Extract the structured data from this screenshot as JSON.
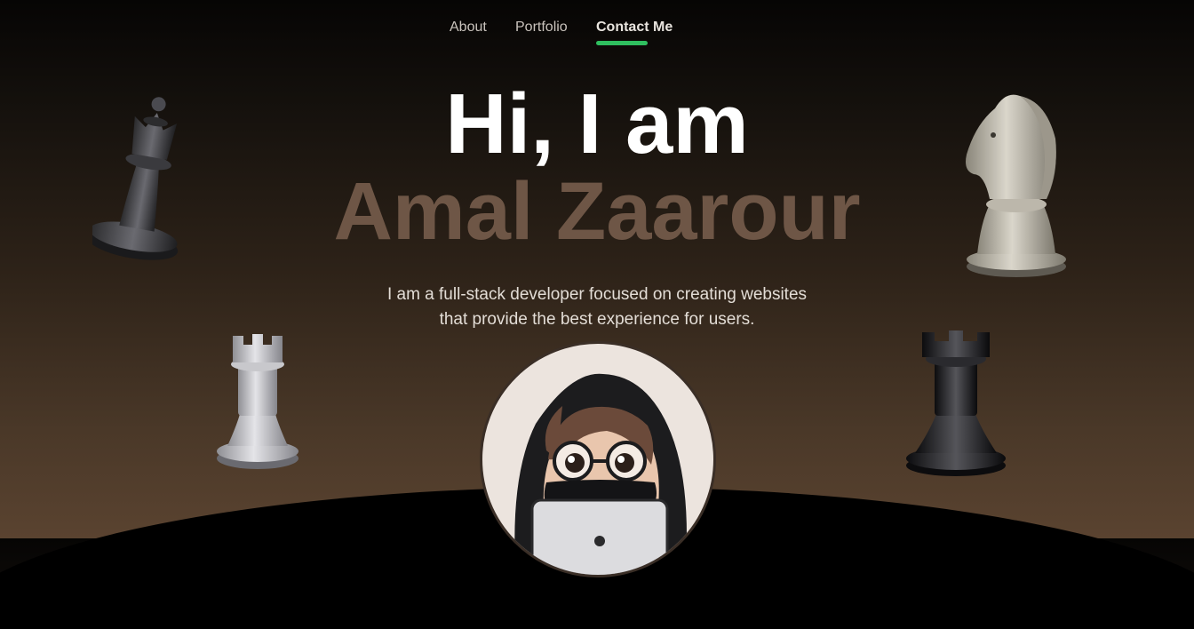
{
  "nav": {
    "items": [
      {
        "label": "About"
      },
      {
        "label": "Portfolio"
      },
      {
        "label": "Contact Me",
        "active": true
      }
    ],
    "active_color": "#2fbf5f"
  },
  "hero": {
    "greeting": "Hi, I am",
    "name": "Amal Zaarour",
    "tagline_line1": "I am a full-stack developer focused on creating websites",
    "tagline_line2": "that provide the best experience for users."
  },
  "decor": {
    "pieces": [
      "black-queen-icon",
      "white-knight-icon",
      "white-rook-icon",
      "black-rook-icon"
    ],
    "avatar": "developer-avatar"
  }
}
